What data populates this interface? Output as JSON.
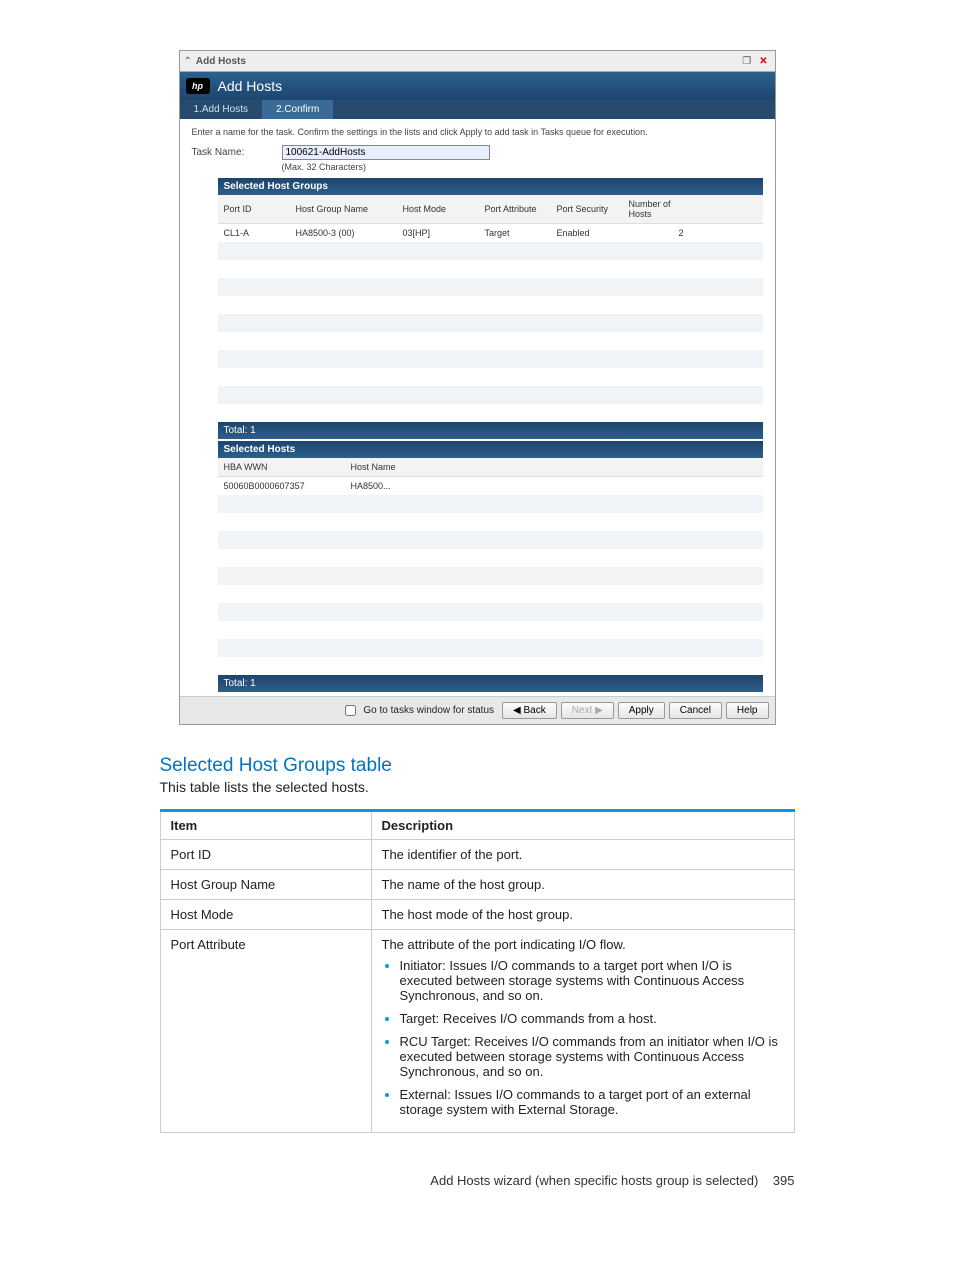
{
  "dialog": {
    "window_title": "Add Hosts",
    "header_title": "Add Hosts",
    "logo_text": "hp",
    "steps": [
      "1.Add Hosts",
      "2.Confirm"
    ],
    "instruction": "Enter a name for the task. Confirm the settings in the lists and click Apply to add task in Tasks queue for execution.",
    "task_name_label": "Task Name:",
    "task_name_value": "100621-AddHosts",
    "task_name_hint": "(Max. 32 Characters)",
    "host_groups": {
      "title": "Selected Host Groups",
      "columns": [
        "Port ID",
        "Host Group Name",
        "Host Mode",
        "Port Attribute",
        "Port Security",
        "Number of Hosts"
      ],
      "rows": [
        {
          "port_id": "CL1-A",
          "hg_name": "HA8500-3 (00)",
          "host_mode": "03[HP]",
          "port_attr": "Target",
          "port_sec": "Enabled",
          "num_hosts": "2"
        }
      ],
      "total_label": "Total:  1"
    },
    "hosts": {
      "title": "Selected Hosts",
      "columns": [
        "HBA WWN",
        "Host Name"
      ],
      "rows": [
        {
          "wwn": "50060B0000607357",
          "host_name": "HA8500..."
        }
      ],
      "total_label": "Total:  1"
    },
    "footer": {
      "checkbox_label": "Go to tasks window for status",
      "back": "◀ Back",
      "next": "Next ▶",
      "apply": "Apply",
      "cancel": "Cancel",
      "help": "Help"
    }
  },
  "doc": {
    "heading": "Selected Host Groups table",
    "lead": "This table lists the selected hosts.",
    "columns": {
      "item": "Item",
      "desc": "Description"
    },
    "rows": [
      {
        "item": "Port ID",
        "desc_text": "The identifier of the port."
      },
      {
        "item": "Host Group Name",
        "desc_text": "The name of the host group."
      },
      {
        "item": "Host Mode",
        "desc_text": "The host mode of the host group."
      },
      {
        "item": "Port Attribute",
        "desc_text": "The attribute of the port indicating I/O flow.",
        "bullets": [
          "Initiator: Issues I/O commands to a target port when I/O is executed between storage systems with Continuous Access Synchronous, and so on.",
          "Target: Receives I/O commands from a host.",
          "RCU Target: Receives I/O commands from an initiator when I/O is executed between storage systems with Continuous Access Synchronous, and so on.",
          "External: Issues I/O commands to a target port of an external storage system with External Storage."
        ]
      }
    ]
  },
  "page_footer": {
    "text": "Add Hosts wizard (when specific hosts group is selected)",
    "page_number": "395"
  }
}
